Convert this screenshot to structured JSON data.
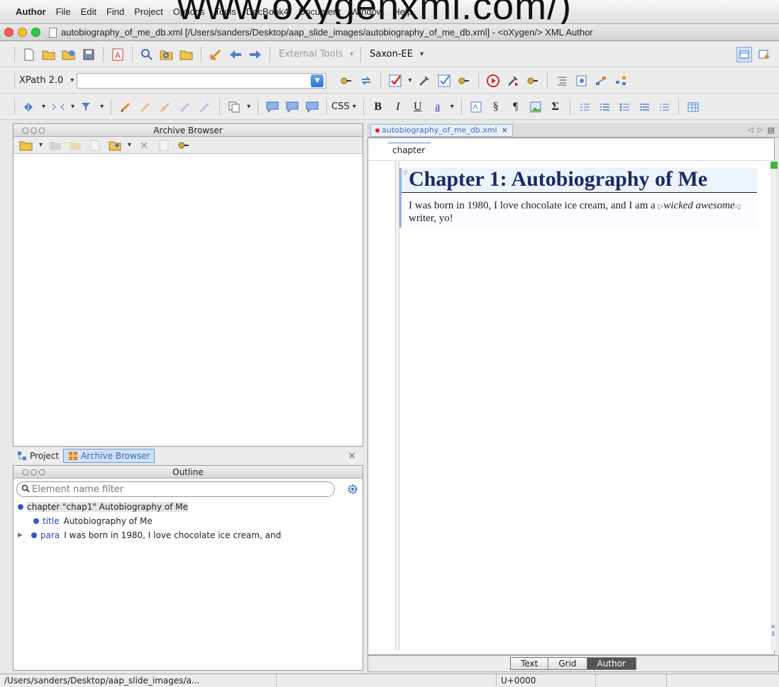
{
  "watermark": "www.oxygenxml.com/)",
  "menubar": {
    "app": "Author",
    "items": [
      "File",
      "Edit",
      "Find",
      "Project",
      "Options",
      "Tools",
      "DocBook4",
      "Document",
      "Window",
      "Help"
    ]
  },
  "window": {
    "title": "autobiography_of_me_db.xml [/Users/sanders/Desktop/aap_slide_images/autobiography_of_me_db.xml] - <oXygen/> XML Author"
  },
  "toolbar1": {
    "external_tools": "External Tools",
    "transform": "Saxon-EE"
  },
  "toolbar2": {
    "xpath_version": "XPath 2.0",
    "xpath_value": ""
  },
  "toolbar3": {
    "css_label": "CSS",
    "bold": "B",
    "italic": "I",
    "underline": "U",
    "link": "a",
    "section": "§",
    "para": "¶",
    "sigma": "Σ"
  },
  "archive": {
    "title": "Archive Browser"
  },
  "view_tabs": {
    "project": "Project",
    "archive": "Archive Browser",
    "close": "×"
  },
  "outline": {
    "title": "Outline",
    "filter_placeholder": "Element name filter",
    "nodes": [
      {
        "tag": "",
        "text": "chapter \"chap1\" Autobiography of Me"
      },
      {
        "tag": "title",
        "text": "Autobiography of Me"
      },
      {
        "tag": "para",
        "text": "I was born in 1980, I love chocolate ice cream, and"
      }
    ]
  },
  "editor": {
    "tab": "autobiography_of_me_db.xml",
    "breadcrumb": "chapter",
    "heading": "Chapter 1: Autobiography of Me",
    "para_before": "I was born in 1980, I love chocolate ice cream, and I am a ",
    "para_em": "wicked awesome",
    "para_after": " writer, yo!",
    "modes": [
      "Text",
      "Grid",
      "Author"
    ],
    "active_mode": "Author"
  },
  "status": {
    "path": "/Users/sanders/Desktop/aap_slide_images/a...",
    "unicode": "U+0000"
  },
  "colors": {
    "accent": "#3b6fc4",
    "heading": "#172a63",
    "traffic_red": "#fc5f57",
    "traffic_yellow": "#fdbc2e",
    "traffic_green": "#34c84a"
  }
}
